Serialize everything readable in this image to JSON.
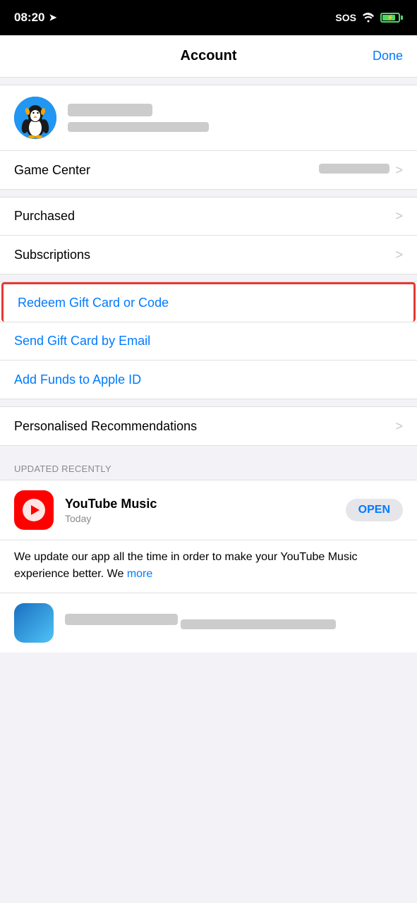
{
  "statusBar": {
    "time": "08:20",
    "sos": "SOS",
    "locationIcon": "▷"
  },
  "header": {
    "title": "Account",
    "doneLabel": "Done"
  },
  "profile": {
    "name_blurred": "████ ████",
    "email_blurred": "████████████████████"
  },
  "gameCenter": {
    "label": "Game Center",
    "value_blurred": "███████"
  },
  "menuItems": [
    {
      "label": "Purchased",
      "type": "nav"
    },
    {
      "label": "Subscriptions",
      "type": "nav"
    }
  ],
  "linkItems": [
    {
      "label": "Redeem Gift Card or Code",
      "type": "link",
      "highlighted": true
    },
    {
      "label": "Send Gift Card by Email",
      "type": "link",
      "highlighted": false
    },
    {
      "label": "Add Funds to Apple ID",
      "type": "link",
      "highlighted": false
    }
  ],
  "personalisedRec": {
    "label": "Personalised Recommendations"
  },
  "updatedSection": {
    "sectionLabel": "UPDATED RECENTLY"
  },
  "youtubeMusic": {
    "name": "YouTube Music",
    "subtitle": "Today",
    "openLabel": "OPEN",
    "description": "We update our app all the time in order to make your YouTube Music experience better. We",
    "more": "more"
  }
}
